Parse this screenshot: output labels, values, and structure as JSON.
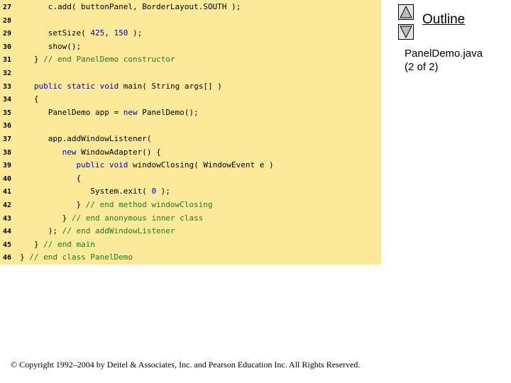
{
  "code": {
    "lines": [
      {
        "num": "27",
        "text": "      c.add( buttonPanel, BorderLayout.SOUTH );"
      },
      {
        "num": "28",
        "text": ""
      },
      {
        "num": "29",
        "text": "      setSize( 425, 150 );"
      },
      {
        "num": "30",
        "text": "      show();"
      },
      {
        "num": "31",
        "text": "   } // end PanelDemo constructor"
      },
      {
        "num": "32",
        "text": ""
      },
      {
        "num": "33",
        "text": "   public static void main( String args[] )"
      },
      {
        "num": "34",
        "text": "   {"
      },
      {
        "num": "35",
        "text": "      PanelDemo app = new PanelDemo();"
      },
      {
        "num": "36",
        "text": ""
      },
      {
        "num": "37",
        "text": "      app.addWindowListener("
      },
      {
        "num": "38",
        "text": "         new WindowAdapter() {"
      },
      {
        "num": "39",
        "text": "            public void windowClosing( WindowEvent e )"
      },
      {
        "num": "40",
        "text": "            {"
      },
      {
        "num": "41",
        "text": "               System.exit( 0 );"
      },
      {
        "num": "42",
        "text": "            } // end method windowClosing"
      },
      {
        "num": "43",
        "text": "         } // end anonymous inner class"
      },
      {
        "num": "44",
        "text": "      ); // end addWindowListener"
      },
      {
        "num": "45",
        "text": "   } // end main"
      },
      {
        "num": "46",
        "text": "} // end class PanelDemo"
      }
    ]
  },
  "nav": {
    "up_icon": "triangle-up-icon",
    "down_icon": "triangle-down-icon"
  },
  "outline_label": "Outline",
  "file": {
    "name": "PanelDemo.java",
    "part": "(2 of 2)"
  },
  "copyright": "© Copyright 1992–2004 by Deitel & Associates, Inc. and Pearson Education Inc. All Rights Reserved.",
  "colors": {
    "panel_bg": "#fde99a",
    "keyword": "#0000cc",
    "comment": "#1f7a1f"
  }
}
